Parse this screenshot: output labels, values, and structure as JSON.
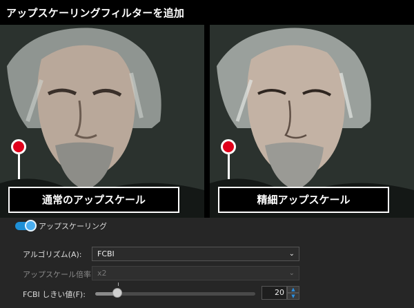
{
  "window": {
    "title": "アップスケーリングフィルターを追加"
  },
  "preview": {
    "left_caption": "通常のアップスケール",
    "right_caption": "精細アップスケール"
  },
  "toggle": {
    "label": "アップスケーリング",
    "on": true
  },
  "settings": {
    "algorithm": {
      "label": "アルゴリズム(A):",
      "value": "FCBI",
      "enabled": true
    },
    "scale": {
      "label": "アップスケール倍率(S):",
      "value": "x2",
      "enabled": false
    },
    "threshold": {
      "label": "FCBI しきい値(F):",
      "value": "20",
      "slider_fraction": 0.14
    }
  },
  "colors": {
    "accent": "#1e8fd6",
    "marker": "#e0001b",
    "panel": "#262626"
  },
  "icons": {
    "dropdown": "chevron-down-icon",
    "spin_up": "caret-up-icon",
    "spin_down": "caret-down-icon"
  }
}
